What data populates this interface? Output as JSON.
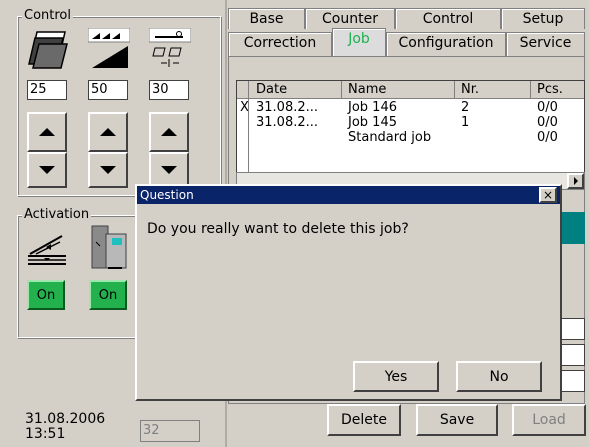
{
  "control": {
    "title": "Control",
    "values": [
      "25",
      "50",
      "30"
    ]
  },
  "activation": {
    "title": "Activation",
    "on_labels": [
      "On",
      "On"
    ]
  },
  "status": {
    "date": "31.08.2006",
    "time": "13:51",
    "counter": "32"
  },
  "tabs": {
    "row1": [
      "Base",
      "Counter",
      "Control",
      "Setup"
    ],
    "row2": [
      "Correction",
      "Job",
      "Configuration",
      "Service"
    ],
    "active": "Job"
  },
  "table": {
    "headers": [
      "Date",
      "Name",
      "Nr.",
      "Pcs."
    ],
    "rows": [
      {
        "mark": "X",
        "date": "31.08.2...",
        "name": "Job 146",
        "nr": "2",
        "pcs": "0/0"
      },
      {
        "mark": "",
        "date": "31.08.2...",
        "name": "Job 145",
        "nr": "1",
        "pcs": "0/0"
      },
      {
        "mark": "",
        "date": "",
        "name": "Standard job",
        "nr": "",
        "pcs": "0/0"
      }
    ]
  },
  "bottom_buttons": {
    "delete": "Delete",
    "save": "Save",
    "load": "Load"
  },
  "dialog": {
    "title": "Question",
    "close": "×",
    "message": "Do you really want to delete this job?",
    "yes": "Yes",
    "no": "No"
  },
  "colors": {
    "dialog_title_bar": "#0a246a",
    "active_tab_text": "#1fb050",
    "on_button": "#22b14c",
    "teal_button": "#008080"
  }
}
